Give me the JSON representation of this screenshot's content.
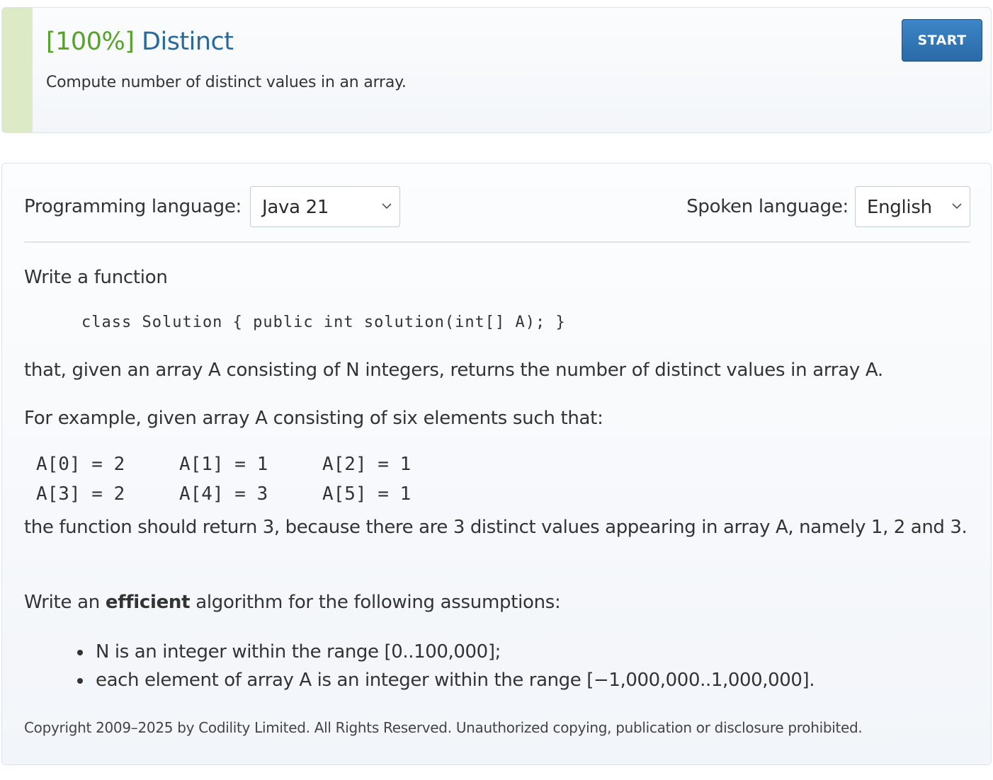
{
  "task": {
    "score": "[100%]",
    "name": "Distinct",
    "summary": "Compute number of distinct values in an array.",
    "start_label": "START",
    "status_color": "#dcebc6"
  },
  "settings": {
    "programming_language_label": "Programming language:",
    "programming_language_value": "Java 21",
    "spoken_language_label": "Spoken language:",
    "spoken_language_value": "English"
  },
  "description": {
    "intro": "Write a function",
    "signature": "class Solution { public int solution(int[] A); }",
    "statement": "that, given an array A consisting of N integers, returns the number of distinct values in array A.",
    "example_intro": "For example, given array A consisting of six elements such that:",
    "array_rows": [
      [
        "A[0] = 2",
        "A[1] = 1",
        "A[2] = 1"
      ],
      [
        "A[3] = 2",
        "A[4] = 3",
        "A[5] = 1"
      ]
    ],
    "result": "the function should return 3, because there are 3 distinct values appearing in array A, namely 1, 2 and 3.",
    "efficiency_prefix": "Write an ",
    "efficiency_bold": "efficient",
    "efficiency_suffix": " algorithm for the following assumptions:",
    "assumptions": [
      "N is an integer within the range [0..100,000];",
      "each element of array A is an integer within the range [−1,000,000..1,000,000]."
    ],
    "copyright": "Copyright 2009–2025 by Codility Limited. All Rights Reserved. Unauthorized copying, publication or disclosure prohibited."
  },
  "colors": {
    "title_blue": "#2a6a9b",
    "score_green": "#56a22c",
    "button_blue": "#2a6aa8"
  },
  "icons": {
    "select_arrow": "chevron-down-icon"
  }
}
